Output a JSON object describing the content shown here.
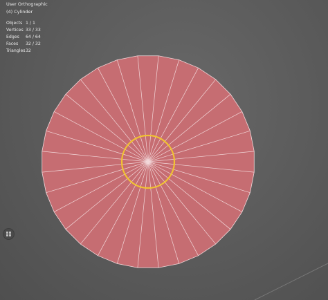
{
  "header": {
    "view_name": "User Orthographic",
    "object_name": "(4) Cylinder"
  },
  "stats": [
    {
      "label": "Objects",
      "value": "1 / 1"
    },
    {
      "label": "Vertices",
      "value": "33 / 33"
    },
    {
      "label": "Edges",
      "value": "64 / 64"
    },
    {
      "label": "Faces",
      "value": "32 / 32"
    },
    {
      "label": "Triangles",
      "value": "32"
    }
  ],
  "mesh": {
    "segments": 32,
    "face_color": "#c66d72",
    "edge_color": "#f2d8da",
    "pivot_ring_color": "#f1c232"
  },
  "viewport_colors": {
    "grid_line": "#7a7a7a"
  },
  "nav_icon": "grid-icon"
}
